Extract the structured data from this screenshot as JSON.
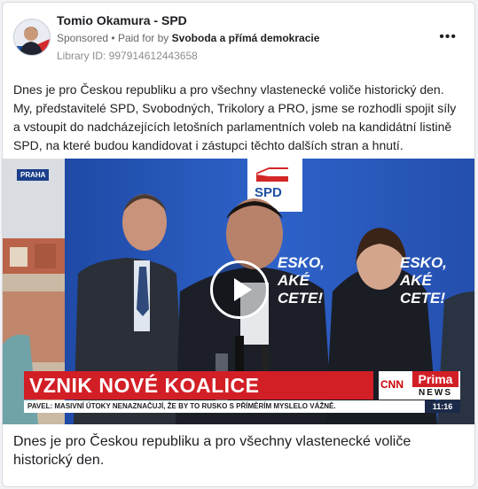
{
  "post": {
    "page_name": "Tomio Okamura - SPD",
    "sponsored": "Sponsored",
    "paid_for_prefix": "Paid for by",
    "paid_for_by": "Svoboda a přímá demokracie",
    "library_id": "Library ID: 997914612443658",
    "more_icon": "more-options-icon",
    "text": "Dnes je pro Českou republiku a pro všechny vlastenecké voliče historický den. My, představitelé SPD, Svobodných, Trikolory a PRO, jsme se rozhodli spojit síly a vstoupit do nadcházejících letošních parlamentních voleb na kandidátní listině SPD, na které budou kandidovat i zástupci těchto dalších stran a hnutí."
  },
  "video": {
    "location_tag": "PRAHA",
    "banner_headline": "VZNIK NOVÉ KOALICE",
    "ticker": "PAVEL: MASIVNÍ ÚTOKY NENAZNAČUJÍ, ŽE BY TO RUSKO S PŘÍMĚRÍM MYSLELO VÁŽNĚ.",
    "channel_logo_top": "CNN",
    "channel_logo_main": "Prima",
    "channel_logo_sub": "NEWS",
    "clock": "11:16",
    "backdrop_logo": "SPD",
    "backdrop_text_left": "ESKO,\nAKÉ\nCETE!",
    "backdrop_text_right": "ESKO,\nAKÉ\nCETE!",
    "play_icon": "play-icon"
  },
  "caption": "Dnes je pro Českou republiku a pro všechny vlastenecké voliče historický den."
}
